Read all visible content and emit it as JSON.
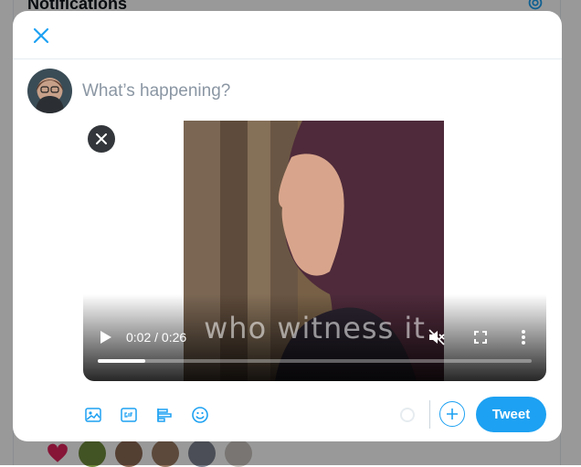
{
  "background": {
    "title": "Notifications",
    "icons": [
      "gear-icon",
      "heart-icon"
    ]
  },
  "modal": {
    "close_icon": "close-icon",
    "compose_placeholder": "What’s happening?",
    "media": {
      "caption": "who witness it",
      "time": "0:02 / 0:26",
      "progress_fraction": 0.11,
      "icons": [
        "play-icon",
        "muted-icon",
        "fullscreen-icon",
        "more-vertical-icon",
        "close-icon"
      ]
    },
    "toolbar": {
      "icons": [
        "image-icon",
        "gif-icon",
        "poll-icon",
        "emoji-icon"
      ]
    },
    "tweet_label": "Tweet",
    "colors": {
      "accent": "#1da1f2",
      "overlay": "rgba(0,0,0,0.4)"
    }
  }
}
